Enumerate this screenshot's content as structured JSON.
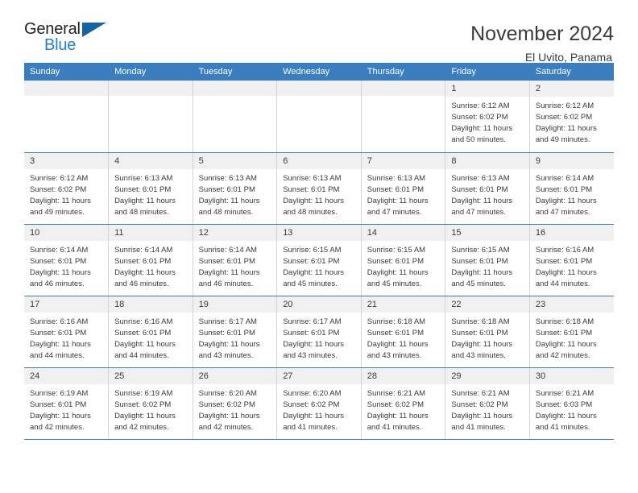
{
  "brand": {
    "word_one": "General",
    "word_two": "Blue",
    "logo_icon": "blue-triangle-icon"
  },
  "header": {
    "title": "November 2024",
    "subtitle": "El Uvito, Panama"
  },
  "calendar": {
    "weekday_headers": [
      "Sunday",
      "Monday",
      "Tuesday",
      "Wednesday",
      "Thursday",
      "Friday",
      "Saturday"
    ],
    "accent_color": "#3a7ebf",
    "daynum_band_color": "#f0f0f0",
    "text_color": "#3a3a3a",
    "labels": {
      "sunrise": "Sunrise:",
      "sunset": "Sunset:",
      "daylight": "Daylight:"
    },
    "weeks": [
      [
        {
          "day": "",
          "empty": true
        },
        {
          "day": "",
          "empty": true
        },
        {
          "day": "",
          "empty": true
        },
        {
          "day": "",
          "empty": true
        },
        {
          "day": "",
          "empty": true
        },
        {
          "day": "1",
          "sunrise": "Sunrise: 6:12 AM",
          "sunset": "Sunset: 6:02 PM",
          "daylight": "Daylight: 11 hours and 50 minutes."
        },
        {
          "day": "2",
          "sunrise": "Sunrise: 6:12 AM",
          "sunset": "Sunset: 6:02 PM",
          "daylight": "Daylight: 11 hours and 49 minutes."
        }
      ],
      [
        {
          "day": "3",
          "sunrise": "Sunrise: 6:12 AM",
          "sunset": "Sunset: 6:02 PM",
          "daylight": "Daylight: 11 hours and 49 minutes."
        },
        {
          "day": "4",
          "sunrise": "Sunrise: 6:13 AM",
          "sunset": "Sunset: 6:01 PM",
          "daylight": "Daylight: 11 hours and 48 minutes."
        },
        {
          "day": "5",
          "sunrise": "Sunrise: 6:13 AM",
          "sunset": "Sunset: 6:01 PM",
          "daylight": "Daylight: 11 hours and 48 minutes."
        },
        {
          "day": "6",
          "sunrise": "Sunrise: 6:13 AM",
          "sunset": "Sunset: 6:01 PM",
          "daylight": "Daylight: 11 hours and 48 minutes."
        },
        {
          "day": "7",
          "sunrise": "Sunrise: 6:13 AM",
          "sunset": "Sunset: 6:01 PM",
          "daylight": "Daylight: 11 hours and 47 minutes."
        },
        {
          "day": "8",
          "sunrise": "Sunrise: 6:13 AM",
          "sunset": "Sunset: 6:01 PM",
          "daylight": "Daylight: 11 hours and 47 minutes."
        },
        {
          "day": "9",
          "sunrise": "Sunrise: 6:14 AM",
          "sunset": "Sunset: 6:01 PM",
          "daylight": "Daylight: 11 hours and 47 minutes."
        }
      ],
      [
        {
          "day": "10",
          "sunrise": "Sunrise: 6:14 AM",
          "sunset": "Sunset: 6:01 PM",
          "daylight": "Daylight: 11 hours and 46 minutes."
        },
        {
          "day": "11",
          "sunrise": "Sunrise: 6:14 AM",
          "sunset": "Sunset: 6:01 PM",
          "daylight": "Daylight: 11 hours and 46 minutes."
        },
        {
          "day": "12",
          "sunrise": "Sunrise: 6:14 AM",
          "sunset": "Sunset: 6:01 PM",
          "daylight": "Daylight: 11 hours and 46 minutes."
        },
        {
          "day": "13",
          "sunrise": "Sunrise: 6:15 AM",
          "sunset": "Sunset: 6:01 PM",
          "daylight": "Daylight: 11 hours and 45 minutes."
        },
        {
          "day": "14",
          "sunrise": "Sunrise: 6:15 AM",
          "sunset": "Sunset: 6:01 PM",
          "daylight": "Daylight: 11 hours and 45 minutes."
        },
        {
          "day": "15",
          "sunrise": "Sunrise: 6:15 AM",
          "sunset": "Sunset: 6:01 PM",
          "daylight": "Daylight: 11 hours and 45 minutes."
        },
        {
          "day": "16",
          "sunrise": "Sunrise: 6:16 AM",
          "sunset": "Sunset: 6:01 PM",
          "daylight": "Daylight: 11 hours and 44 minutes."
        }
      ],
      [
        {
          "day": "17",
          "sunrise": "Sunrise: 6:16 AM",
          "sunset": "Sunset: 6:01 PM",
          "daylight": "Daylight: 11 hours and 44 minutes."
        },
        {
          "day": "18",
          "sunrise": "Sunrise: 6:16 AM",
          "sunset": "Sunset: 6:01 PM",
          "daylight": "Daylight: 11 hours and 44 minutes."
        },
        {
          "day": "19",
          "sunrise": "Sunrise: 6:17 AM",
          "sunset": "Sunset: 6:01 PM",
          "daylight": "Daylight: 11 hours and 43 minutes."
        },
        {
          "day": "20",
          "sunrise": "Sunrise: 6:17 AM",
          "sunset": "Sunset: 6:01 PM",
          "daylight": "Daylight: 11 hours and 43 minutes."
        },
        {
          "day": "21",
          "sunrise": "Sunrise: 6:18 AM",
          "sunset": "Sunset: 6:01 PM",
          "daylight": "Daylight: 11 hours and 43 minutes."
        },
        {
          "day": "22",
          "sunrise": "Sunrise: 6:18 AM",
          "sunset": "Sunset: 6:01 PM",
          "daylight": "Daylight: 11 hours and 43 minutes."
        },
        {
          "day": "23",
          "sunrise": "Sunrise: 6:18 AM",
          "sunset": "Sunset: 6:01 PM",
          "daylight": "Daylight: 11 hours and 42 minutes."
        }
      ],
      [
        {
          "day": "24",
          "sunrise": "Sunrise: 6:19 AM",
          "sunset": "Sunset: 6:01 PM",
          "daylight": "Daylight: 11 hours and 42 minutes."
        },
        {
          "day": "25",
          "sunrise": "Sunrise: 6:19 AM",
          "sunset": "Sunset: 6:02 PM",
          "daylight": "Daylight: 11 hours and 42 minutes."
        },
        {
          "day": "26",
          "sunrise": "Sunrise: 6:20 AM",
          "sunset": "Sunset: 6:02 PM",
          "daylight": "Daylight: 11 hours and 42 minutes."
        },
        {
          "day": "27",
          "sunrise": "Sunrise: 6:20 AM",
          "sunset": "Sunset: 6:02 PM",
          "daylight": "Daylight: 11 hours and 41 minutes."
        },
        {
          "day": "28",
          "sunrise": "Sunrise: 6:21 AM",
          "sunset": "Sunset: 6:02 PM",
          "daylight": "Daylight: 11 hours and 41 minutes."
        },
        {
          "day": "29",
          "sunrise": "Sunrise: 6:21 AM",
          "sunset": "Sunset: 6:02 PM",
          "daylight": "Daylight: 11 hours and 41 minutes."
        },
        {
          "day": "30",
          "sunrise": "Sunrise: 6:21 AM",
          "sunset": "Sunset: 6:03 PM",
          "daylight": "Daylight: 11 hours and 41 minutes."
        }
      ]
    ]
  }
}
